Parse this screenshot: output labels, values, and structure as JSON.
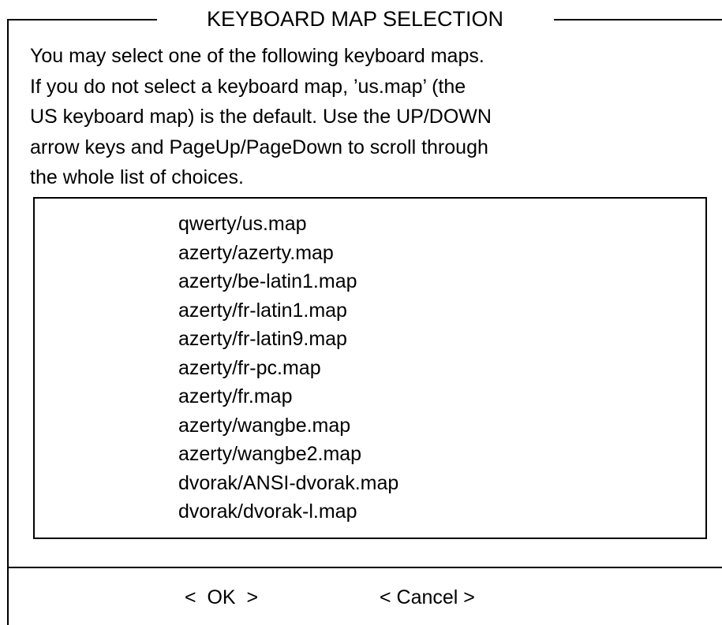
{
  "dialog": {
    "title": "KEYBOARD MAP SELECTION",
    "description_lines": [
      "You may select one of the following keyboard maps.",
      "If you do not select a keyboard map, ’us.map’ (the",
      "US keyboard map) is the default.  Use the UP/DOWN",
      "arrow keys and PageUp/PageDown to scroll through",
      "the whole list of choices."
    ],
    "keymaps": [
      "qwerty/us.map",
      "azerty/azerty.map",
      "azerty/be-latin1.map",
      "azerty/fr-latin1.map",
      "azerty/fr-latin9.map",
      "azerty/fr-pc.map",
      "azerty/fr.map",
      "azerty/wangbe.map",
      "azerty/wangbe2.map",
      "dvorak/ANSI-dvorak.map",
      "dvorak/dvorak-l.map"
    ],
    "buttons": {
      "ok_label": "<  OK  >",
      "cancel_label": "< Cancel >"
    }
  }
}
